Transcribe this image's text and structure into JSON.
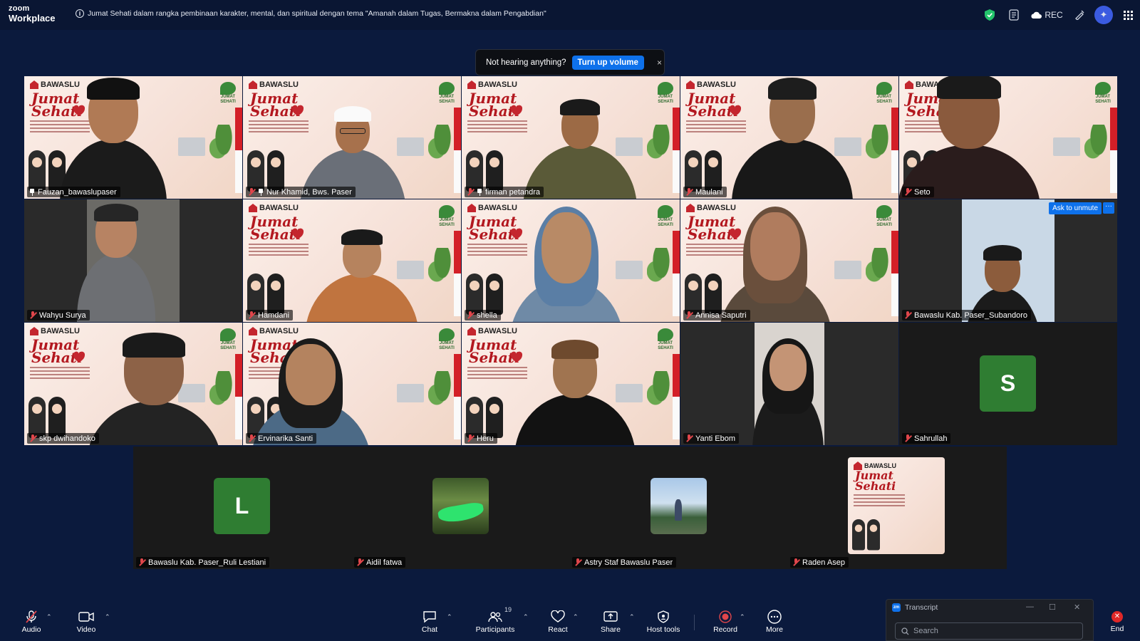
{
  "app": {
    "logo_line1": "zoom",
    "logo_line2": "Workplace"
  },
  "meeting": {
    "topic": "Jumat Sehati dalam rangka pembinaan karakter, mental, dan spiritual dengan tema \"Amanah dalam Tugas, Bermakna dalam Pengabdian\""
  },
  "top_right": {
    "rec_label": "REC"
  },
  "toast": {
    "text": "Not hearing anything?",
    "button": "Turn up volume",
    "close": "×"
  },
  "banner": {
    "org": "BAWASLU",
    "title_line1": "Jumat",
    "title_line2": "Sehati",
    "badge_line1": "JUMAT",
    "badge_line2": "SEHATI"
  },
  "participants": [
    {
      "name": "Fauzan_bawaslupaser",
      "pinned": true,
      "active_speaker": true
    },
    {
      "name": "Nur Khamid, Bws. Paser",
      "pinned": true
    },
    {
      "name": "firman petandra",
      "pinned": true
    },
    {
      "name": "Maulani"
    },
    {
      "name": "Seto"
    },
    {
      "name": "Wahyu Surya"
    },
    {
      "name": "Hamdani"
    },
    {
      "name": "shella"
    },
    {
      "name": "Annisa Saputri"
    },
    {
      "name": "Bawaslu Kab. Paser_Subandoro"
    },
    {
      "name": "skp dwihandoko"
    },
    {
      "name": "Ervinarika Santi"
    },
    {
      "name": "Heru"
    },
    {
      "name": "Yanti Ebom"
    },
    {
      "name": "Sahrullah",
      "avatar_letter": "S",
      "avatar_color": "#2f7d32"
    },
    {
      "name": "Bawaslu Kab. Paser_Ruli Lestiani",
      "avatar_letter": "L",
      "avatar_color": "#2f7d32"
    },
    {
      "name": "Aidil fatwa"
    },
    {
      "name": "Astry Staf Bawaslu Paser"
    },
    {
      "name": "Raden Asep"
    }
  ],
  "tile_actions": {
    "ask_to_unmute": "Ask to unmute",
    "more": "···"
  },
  "toolbar": {
    "audio": "Audio",
    "video": "Video",
    "chat": "Chat",
    "participants": "Participants",
    "participants_count": "19",
    "react": "React",
    "share": "Share",
    "host_tools": "Host tools",
    "record": "Record",
    "more": "More",
    "end": "End"
  },
  "transcript": {
    "title": "Transcript",
    "search_placeholder": "Search"
  },
  "colors": {
    "accent": "#0e71eb",
    "active_speaker": "#23d9a0",
    "muted": "#e0464b",
    "end": "#e02828"
  }
}
